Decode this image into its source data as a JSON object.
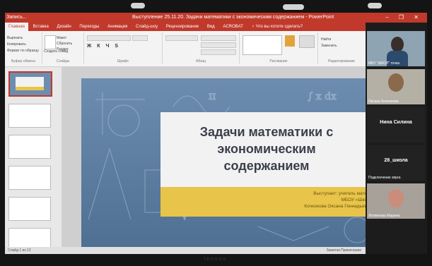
{
  "window": {
    "app_label": "Запись...",
    "title": "Выступление 25.11.20. Задачи математики с экономическим содержанием - PowerPoint",
    "controls": "–  ❐  ✕"
  },
  "ribbon": {
    "tabs": [
      "Главная",
      "Вставка",
      "Дизайн",
      "Переходы",
      "Анимация",
      "Слайд-шоу",
      "Рецензирование",
      "Вид",
      "ACROBAT",
      "♀ Что вы хотите сделать?"
    ],
    "active_tab": 0,
    "groups": [
      "Буфер обмена",
      "Слайды",
      "Шрифт",
      "Абзац",
      "Рисование",
      "Редактирование"
    ],
    "clipboard_items": [
      "Вырезать",
      "Копировать",
      "Формат по образцу"
    ],
    "slides_items": [
      "Создать слайд",
      "Макет",
      "Сбросить",
      "Раздел"
    ],
    "find_label": "Найти",
    "replace_label": "Заменить"
  },
  "slide": {
    "title_line1": "Задачи математики с",
    "title_line2": "экономическим",
    "title_line3": "содержанием",
    "subtitle_line1": "Выступает: учитель мате",
    "subtitle_line2": "МБОУ «Шко",
    "subtitle_line3": "Кочнокова Оксана Геннадьев"
  },
  "video": {
    "tile1_name": "МБУ \"ШКОЛ\" точка",
    "tile2_name": "Оксана Кочнокова",
    "tile3_center": "Нина Силина",
    "tile4_center": "28_школа",
    "tile4_name": "Подключение звука",
    "tile5_name": "Литвинова Марина"
  },
  "status": {
    "left": "Слайд 1 из 12",
    "right": "Заметки   Примечания"
  },
  "bezel": {
    "brand": "lenovo"
  }
}
